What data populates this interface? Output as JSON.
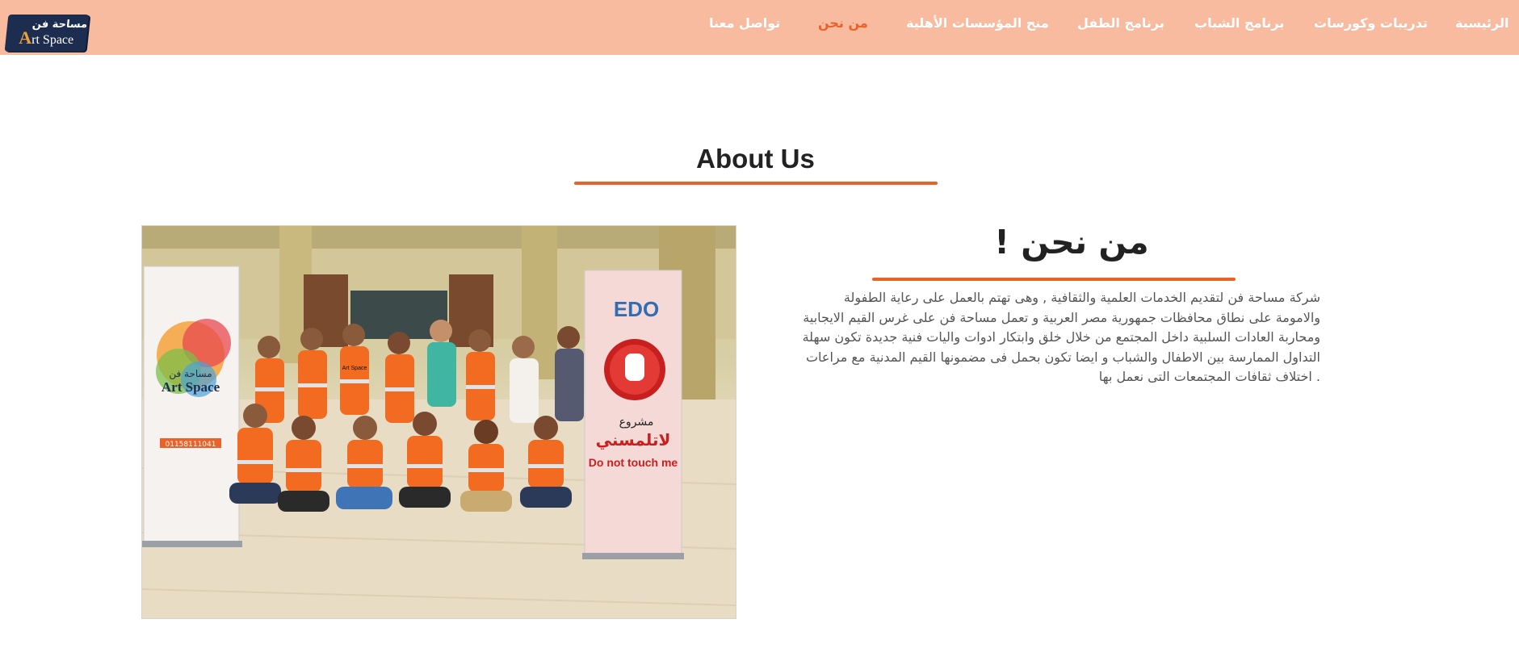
{
  "logo": {
    "arabic": "مساحة فن",
    "english_initial": "A",
    "english_rest": "rt Space"
  },
  "nav": {
    "items": [
      {
        "label": "الرئيسية",
        "active": false
      },
      {
        "label": "تدريبات وكورسات",
        "active": false
      },
      {
        "label": "برنامج الشباب",
        "active": false
      },
      {
        "label": "برنامج الطفل",
        "active": false
      },
      {
        "label": "منح المؤسسات الأهلية",
        "active": false
      },
      {
        "label": "من نحن",
        "active": true
      },
      {
        "label": "تواصل معنا",
        "active": false
      }
    ]
  },
  "section": {
    "title": "About Us"
  },
  "about": {
    "heading": "من نحن",
    "heading_mark": "!",
    "lines": [
      "شركة مساحة فن لتقديم الخدمات العلمية والثقافية , وهى تهتم بالعمل على رعاية الطفولة",
      "والامومة على نطاق محافظات جمهورية مصر العربية و تعمل مساحة فن على غرس القيم الايجابية",
      "ومحاربة العادات السلبية داخل المجتمع من خلال خلق وابتكار ادوات واليات فنية جديدة تكون سهلة",
      "التداول الممارسة بين الاطفال والشباب و ايضا تكون بحمل فى مضمونها القيم المدنية مع مراعات",
      ". اختلاف ثقافات المجتمعات التى نعمل بها"
    ]
  },
  "photo": {
    "banner_left_text": "Art Space",
    "banner_left_arabic": "مساحة فن",
    "banner_left_phone": "01158111041",
    "banner_right_logo": "EDO",
    "banner_right_arabic_small": "مشروع",
    "banner_right_arabic_big": "لاتلمسني",
    "banner_right_english": "Do not touch me",
    "vest_text": "Art Space"
  },
  "colors": {
    "nav_bg": "#f8bba0",
    "accent": "#e8622a",
    "logo_bg": "#1d2d4f"
  }
}
